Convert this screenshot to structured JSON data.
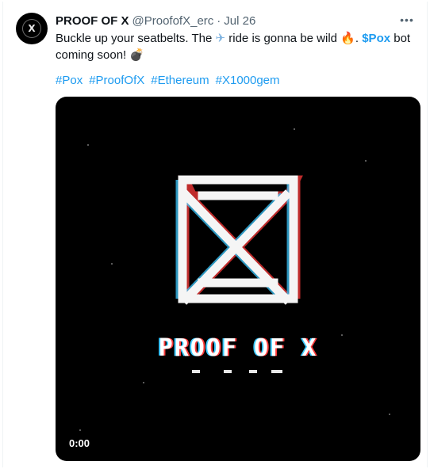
{
  "tweet": {
    "display_name": "PROOF OF X",
    "handle": "@ProofofX_erc",
    "separator": "·",
    "date": "Jul 26",
    "more_label": "•••",
    "avatar_letter": "X",
    "text_part1": "Buckle up your seatbelts. The ",
    "text_part2": " ride is gonna be wild ",
    "text_part3": ". ",
    "cashtag": "$Pox",
    "text_part4": " bot coming soon! ",
    "emoji_plane": "✈",
    "emoji_fire": "🔥",
    "emoji_bomb": "💣",
    "hashtags": [
      "#Pox",
      "#ProofOfX",
      "#Ethereum",
      "#X1000gem"
    ]
  },
  "media": {
    "video_time": "0:00",
    "wordmark": "PROOF OF X",
    "bg_color": "#000000"
  },
  "colors": {
    "link": "#1d9bf0",
    "secondary": "#536471",
    "primary": "#0f1419"
  }
}
